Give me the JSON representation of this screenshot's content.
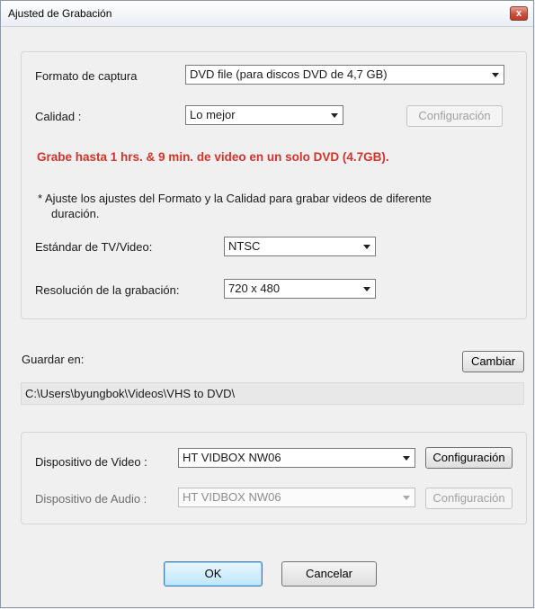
{
  "window": {
    "title": "Ajusted de Grabación",
    "close": "x"
  },
  "capture": {
    "format_label": "Formato de captura",
    "format_value": "DVD file (para discos DVD de 4,7 GB)",
    "quality_label": "Calidad :",
    "quality_value": "Lo mejor",
    "config_button": "Configuración",
    "warning": "Grabe hasta 1 hrs. & 9 min. de video en un solo DVD (4.7GB).",
    "note_line1": "*  Ajuste los ajustes del Formato y la Calidad para grabar videos de diferente",
    "note_line2": "duración.",
    "tv_label": "Estándar de TV/Video:",
    "tv_value": "NTSC",
    "resolution_label": "Resolución de la grabación:",
    "resolution_value": "720 x 480"
  },
  "save": {
    "label": "Guardar en:",
    "change_button": "Cambiar",
    "path": "C:\\Users\\byungbok\\Videos\\VHS to DVD\\"
  },
  "devices": {
    "video_label": "Dispositivo de Video :",
    "video_value": "HT VIDBOX NW06",
    "video_config": "Configuración",
    "audio_label": "Dispositivo de Audio :",
    "audio_value": "HT VIDBOX NW06",
    "audio_config": "Configuración"
  },
  "footer": {
    "ok": "OK",
    "cancel": "Cancelar"
  }
}
